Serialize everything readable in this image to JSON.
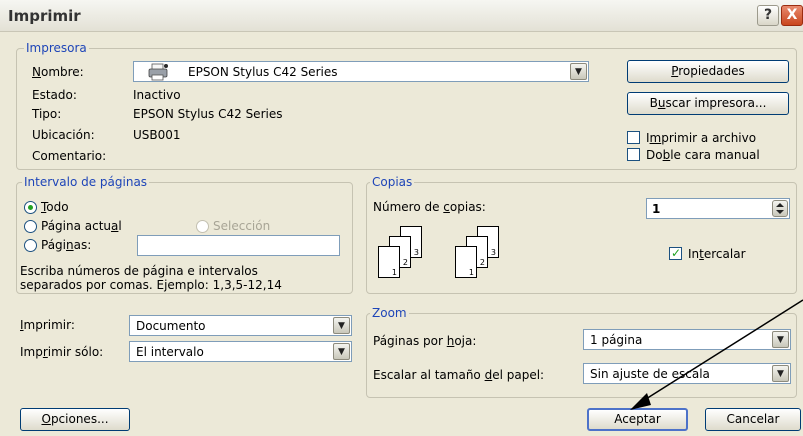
{
  "window": {
    "title": "Imprimir",
    "help_label": "?",
    "close_label": "X"
  },
  "printer": {
    "legend": "Impresora",
    "name_label": "Nombre:",
    "name_value": "EPSON Stylus C42 Series",
    "estado_label": "Estado:",
    "estado_value": "Inactivo",
    "tipo_label": "Tipo:",
    "tipo_value": "EPSON Stylus C42 Series",
    "ubicacion_label": "Ubicación:",
    "ubicacion_value": "USB001",
    "comentario_label": "Comentario:",
    "properties_button": "Propiedades",
    "find_printer_button": "Buscar impresora...",
    "print_to_file_label": "Imprimir a archivo",
    "print_to_file_checked": false,
    "duplex_label": "Doble cara manual",
    "duplex_checked": false
  },
  "page_range": {
    "legend": "Intervalo de páginas",
    "all_label": "Todo",
    "current_label": "Página actual",
    "selection_label": "Selección",
    "pages_label": "Páginas:",
    "pages_value": "",
    "selected": "all",
    "hint_line1": "Escriba números de página e intervalos",
    "hint_line2": "separados por comas. Ejemplo: 1,3,5-12,14"
  },
  "copies": {
    "legend": "Copias",
    "number_label": "Número de copias:",
    "number_value": "1",
    "collate_label": "Intercalar",
    "collate_checked": true,
    "stack_numbers": [
      "3",
      "2",
      "1"
    ]
  },
  "print_what": {
    "imprimir_label": "Imprimir:",
    "imprimir_value": "Documento",
    "solo_label": "Imprimir sólo:",
    "solo_value": "El intervalo"
  },
  "zoom": {
    "legend": "Zoom",
    "pages_per_sheet_label": "Páginas por hoja:",
    "pages_per_sheet_value": "1 página",
    "scale_label": "Escalar al tamaño del papel:",
    "scale_value": "Sin ajuste de escala"
  },
  "footer": {
    "options_button": "Opciones...",
    "ok_button": "Aceptar",
    "cancel_button": "Cancelar"
  },
  "icons": {
    "dropdown_arrow": "chevron-down-icon",
    "printer": "printer-icon",
    "spinner": "spinner-icon"
  },
  "colors": {
    "group_legend": "#1e45b8",
    "dialog_bg": "#ece9d8",
    "close_button": "#c9461e",
    "check_mark": "#21a121"
  }
}
